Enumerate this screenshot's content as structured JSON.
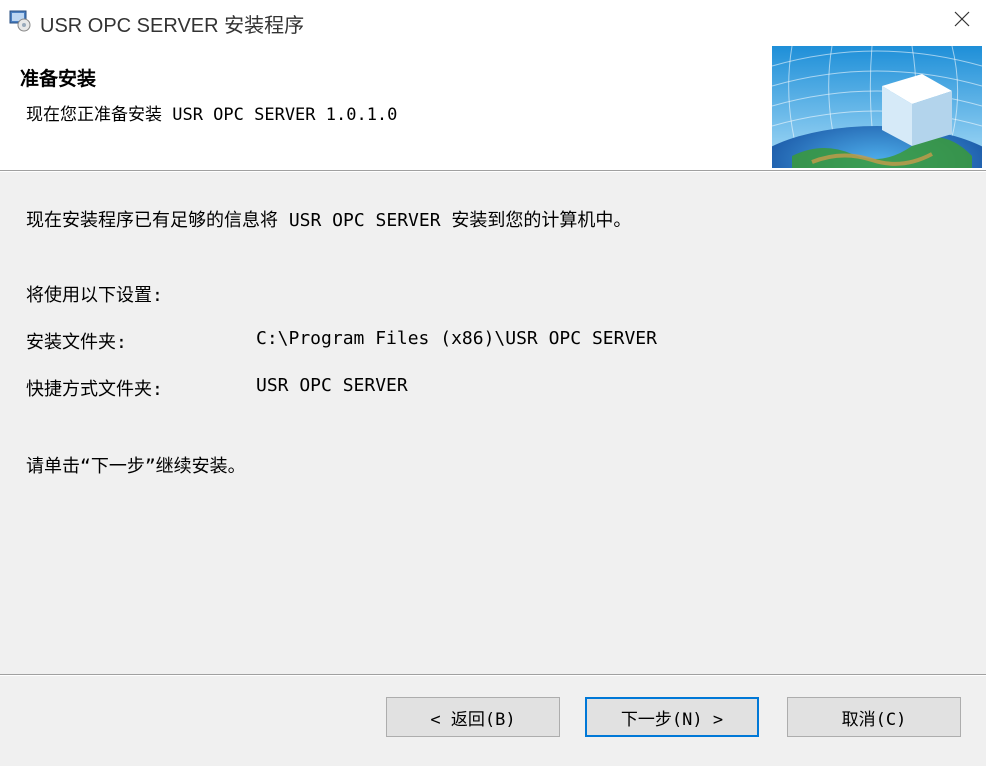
{
  "window": {
    "title": "USR OPC SERVER 安装程序",
    "app_icon": "installer-icon",
    "close_icon": "close-icon"
  },
  "header": {
    "title": "准备安装",
    "subtitle": "现在您正准备安装 USR OPC SERVER 1.0.1.0",
    "banner_image": "globe-cube-banner"
  },
  "content": {
    "intro": "现在安装程序已有足够的信息将 USR OPC SERVER 安装到您的计算机中。",
    "settings_heading": "将使用以下设置:",
    "settings": [
      {
        "label": "安装文件夹:",
        "value": "C:\\Program Files (x86)\\USR OPC SERVER"
      },
      {
        "label": "快捷方式文件夹:",
        "value": "USR OPC SERVER"
      }
    ],
    "instruction": "请单击“下一步”继续安装。"
  },
  "buttons": {
    "back": "< 返回(B)",
    "next": "下一步(N) >",
    "cancel": "取消(C)"
  },
  "colors": {
    "accent": "#0078d7",
    "window_bg": "#f0f0f0",
    "header_bg": "#ffffff"
  }
}
